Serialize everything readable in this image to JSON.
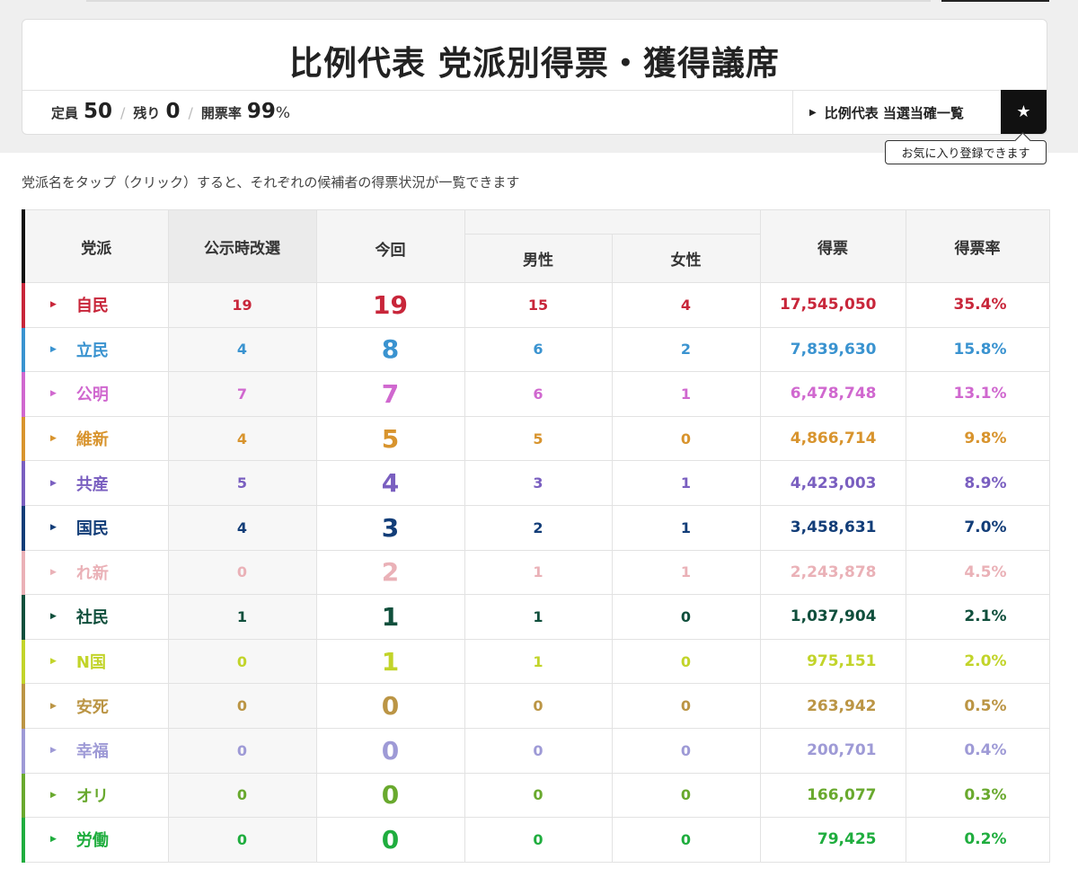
{
  "header": {
    "title": "比例代表 党派別得票・獲得議席",
    "stats": {
      "capacity_label": "定員",
      "capacity_value": "50",
      "remaining_label": "残り",
      "remaining_value": "0",
      "count_rate_label": "開票率",
      "count_rate_value": "99",
      "count_rate_unit": "%",
      "separator": "/"
    },
    "winners_link": "比例代表 当選当確一覧",
    "favorite_tooltip": "お気に入り登録できます"
  },
  "instruction": "党派名をタップ（クリック）すると、それぞれの候補者の得票状況が一覧できます",
  "table": {
    "headers": {
      "party": "党派",
      "previous": "公示時改選",
      "current": "今回",
      "male": "男性",
      "female": "女性",
      "votes": "得票",
      "rate": "得票率"
    },
    "rows": [
      {
        "party": "自民",
        "color": "#c8263a",
        "prev": "19",
        "now": "19",
        "male": "15",
        "female": "4",
        "votes": "17,545,050",
        "rate": "35.4%"
      },
      {
        "party": "立民",
        "color": "#3a93d0",
        "prev": "4",
        "now": "8",
        "male": "6",
        "female": "2",
        "votes": "7,839,630",
        "rate": "15.8%"
      },
      {
        "party": "公明",
        "color": "#d068cf",
        "prev": "7",
        "now": "7",
        "male": "6",
        "female": "1",
        "votes": "6,478,748",
        "rate": "13.1%"
      },
      {
        "party": "維新",
        "color": "#d8942e",
        "prev": "4",
        "now": "5",
        "male": "5",
        "female": "0",
        "votes": "4,866,714",
        "rate": "9.8%"
      },
      {
        "party": "共産",
        "color": "#7a5fc0",
        "prev": "5",
        "now": "4",
        "male": "3",
        "female": "1",
        "votes": "4,423,003",
        "rate": "8.9%"
      },
      {
        "party": "国民",
        "color": "#123d78",
        "prev": "4",
        "now": "3",
        "male": "2",
        "female": "1",
        "votes": "3,458,631",
        "rate": "7.0%"
      },
      {
        "party": "れ新",
        "color": "#eab1b7",
        "prev": "0",
        "now": "2",
        "male": "1",
        "female": "1",
        "votes": "2,243,878",
        "rate": "4.5%"
      },
      {
        "party": "社民",
        "color": "#104f3c",
        "prev": "1",
        "now": "1",
        "male": "1",
        "female": "0",
        "votes": "1,037,904",
        "rate": "2.1%"
      },
      {
        "party": "N国",
        "color": "#c2d42a",
        "prev": "0",
        "now": "1",
        "male": "1",
        "female": "0",
        "votes": "975,151",
        "rate": "2.0%"
      },
      {
        "party": "安死",
        "color": "#bb9545",
        "prev": "0",
        "now": "0",
        "male": "0",
        "female": "0",
        "votes": "263,942",
        "rate": "0.5%"
      },
      {
        "party": "幸福",
        "color": "#9e9ad6",
        "prev": "0",
        "now": "0",
        "male": "0",
        "female": "0",
        "votes": "200,701",
        "rate": "0.4%"
      },
      {
        "party": "オリ",
        "color": "#69a92e",
        "prev": "0",
        "now": "0",
        "male": "0",
        "female": "0",
        "votes": "166,077",
        "rate": "0.3%"
      },
      {
        "party": "労働",
        "color": "#1fad3e",
        "prev": "0",
        "now": "0",
        "male": "0",
        "female": "0",
        "votes": "79,425",
        "rate": "0.2%"
      }
    ]
  },
  "icons": {
    "star": "star-icon",
    "arrow": "triangle-right-icon"
  }
}
